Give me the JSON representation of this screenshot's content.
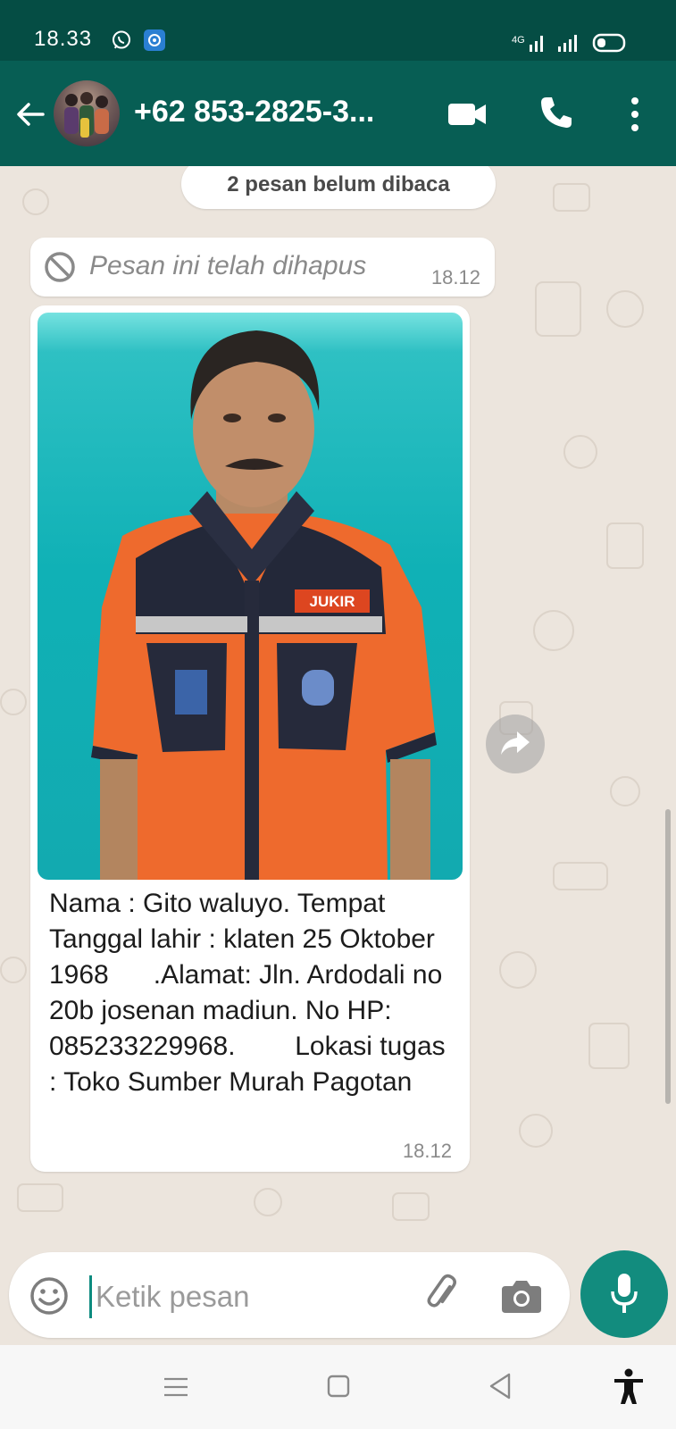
{
  "status_bar": {
    "time": "18.33",
    "network": "4G"
  },
  "header": {
    "contact_name": "+62 853-2825-3...",
    "icons": [
      "back-arrow-icon",
      "video-call-icon",
      "voice-call-icon",
      "more-options-icon"
    ]
  },
  "chat": {
    "unread_banner": "2 pesan belum dibaca",
    "messages": [
      {
        "type": "deleted",
        "text": "Pesan ini telah dihapus",
        "time": "18.12"
      },
      {
        "type": "image",
        "caption": "Nama : Gito waluyo. Tempat Tanggal lahir : klaten 25 Oktober 1968      .Alamat: Jln. Ardodali no 20b josenan madiun. No HP: 085233229968.        Lokasi tugas : Toko Sumber Murah Pagotan",
        "badge_text": "JUKIR",
        "time": "18.12"
      }
    ]
  },
  "composer": {
    "placeholder": "Ketik pesan",
    "value": ""
  },
  "colors": {
    "header": "#075e54",
    "status_bar": "#054d44",
    "accent": "#128c7e",
    "chat_bg": "#ece5dd"
  }
}
